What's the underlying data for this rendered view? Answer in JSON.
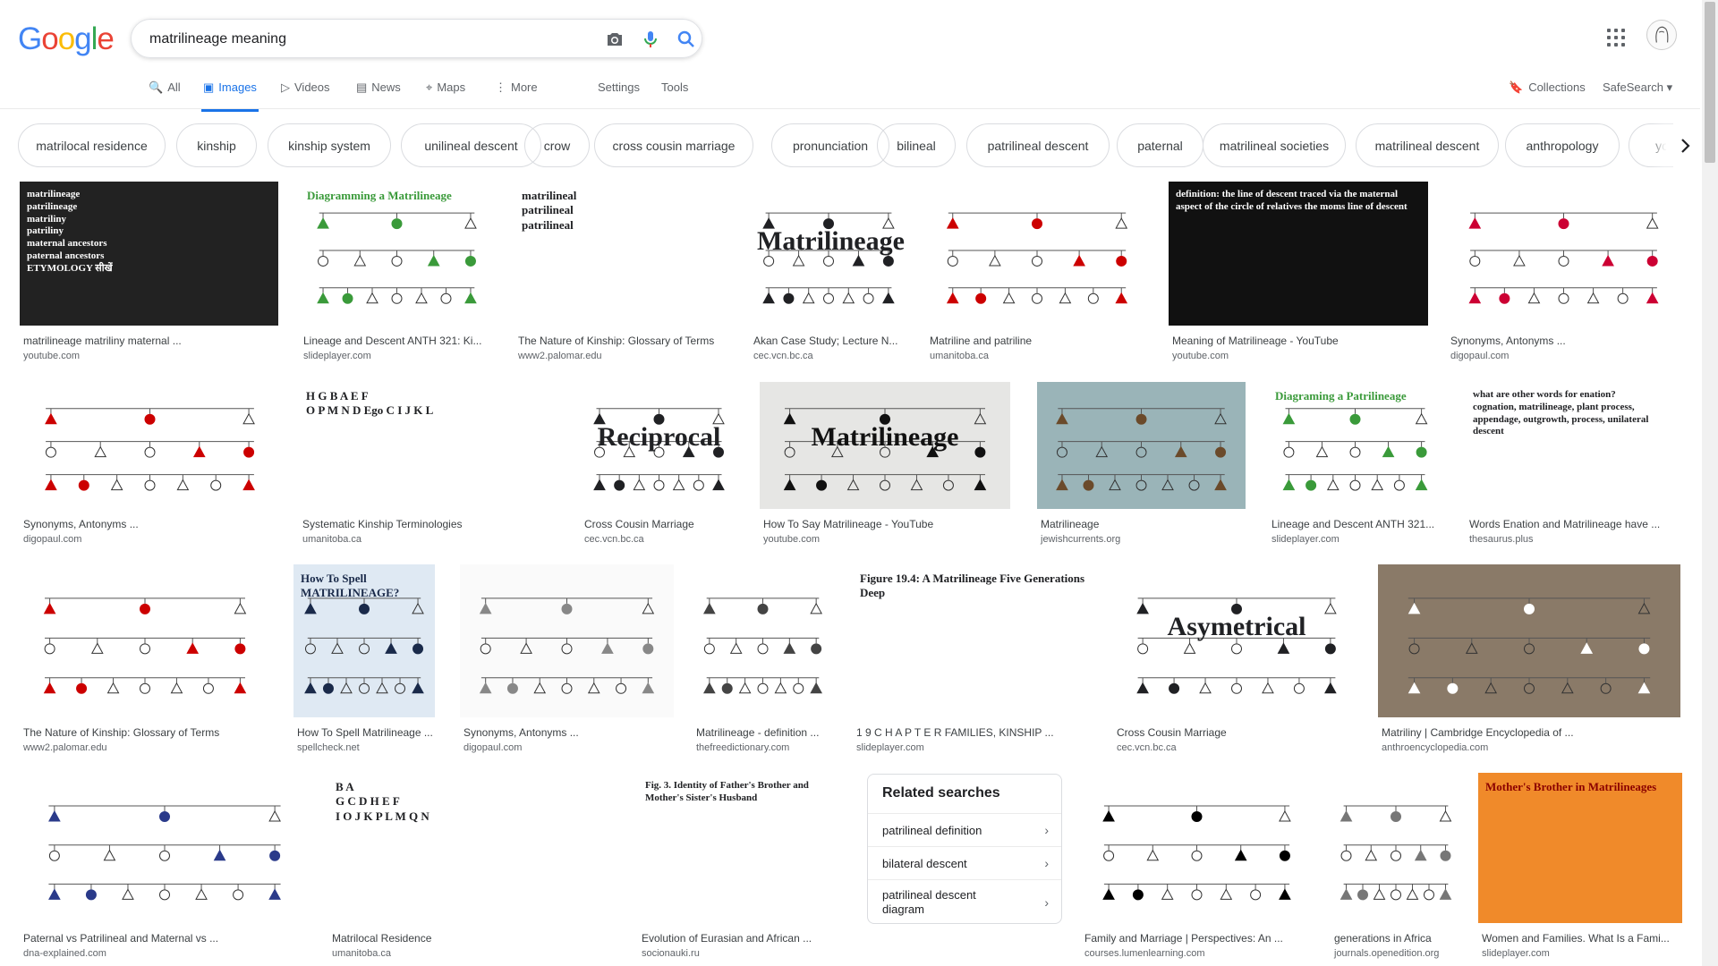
{
  "logo": {
    "letters": [
      "G",
      "o",
      "o",
      "g",
      "l",
      "e"
    ],
    "colors": [
      "#4285f4",
      "#ea4335",
      "#fbbc05",
      "#4285f4",
      "#34a853",
      "#ea4335"
    ]
  },
  "search": {
    "query": "matrilineage meaning"
  },
  "icons": {
    "camera": "camera-icon",
    "mic": "mic-icon",
    "search": "search-icon",
    "apps": "apps-grid-icon"
  },
  "tabs": [
    {
      "label": "All",
      "icon": "🔍"
    },
    {
      "label": "Images",
      "icon": "▣"
    },
    {
      "label": "Videos",
      "icon": "▷"
    },
    {
      "label": "News",
      "icon": "▤"
    },
    {
      "label": "Maps",
      "icon": "⌖"
    },
    {
      "label": "More",
      "icon": "⋮"
    },
    {
      "label": "Settings",
      "icon": ""
    },
    {
      "label": "Tools",
      "icon": ""
    }
  ],
  "right_tools": {
    "collections": "Collections",
    "safesearch": "SafeSearch"
  },
  "chips": [
    "matrilocal residence",
    "kinship",
    "kinship system",
    "unilineal descent",
    "crow",
    "cross cousin marriage",
    "pronunciation",
    "bilineal",
    "patrilineal descent",
    "paternal",
    "matrilineal societies",
    "matrilineal descent",
    "anthropology",
    "youtube"
  ],
  "results": [
    {
      "title": "matrilineage matriliny maternal ...",
      "source": "youtube.com",
      "thumb": {
        "bg": "#222222",
        "text": "matrilineage\npatrilineage\nmatriliny\npatriliny\nmaternal ancestors\npaternal ancestors\nETYMOLOGY सीखें",
        "fg": "#ffffff"
      }
    },
    {
      "title": "Lineage and Descent ANTH 321: Ki...",
      "source": "slideplayer.com",
      "thumb": {
        "bg": "#ffffff",
        "text": "Diagramming a Matrilineage",
        "fg": "#3a9a3a"
      }
    },
    {
      "title": "The Nature of Kinship: Glossary of Terms",
      "source": "www2.palomar.edu",
      "thumb": {
        "bg": "#ffffff",
        "text": "matrilineal\npatrilineal\npatrilineal",
        "fg": "#202124"
      }
    },
    {
      "title": "Akan Case Study; Lecture N...",
      "source": "cec.vcn.bc.ca",
      "thumb": {
        "bg": "#ffffff",
        "text": "Matrilineage",
        "fg": "#202124"
      }
    },
    {
      "title": "Matriline and patriline",
      "source": "umanitoba.ca",
      "thumb": {
        "bg": "#ffffff",
        "text": "",
        "fg": "#cc0000"
      }
    },
    {
      "title": "Meaning of Matrilineage - YouTube",
      "source": "youtube.com",
      "thumb": {
        "bg": "#111111",
        "text": "definition: the line of descent traced via the maternal aspect of the circle of relatives the moms line of descent",
        "fg": "#ffffff"
      }
    },
    {
      "title": "Synonyms, Antonyms ...",
      "source": "digopaul.com",
      "thumb": {
        "bg": "#ffffff",
        "text": "",
        "fg": "#cc0033"
      }
    },
    {
      "title": "Synonyms, Antonyms ...",
      "source": "digopaul.com",
      "thumb": {
        "bg": "#ffffff",
        "text": "",
        "fg": "#cc0000"
      }
    },
    {
      "title": "Systematic Kinship Terminologies",
      "source": "umanitoba.ca",
      "thumb": {
        "bg": "#ffffff",
        "text": "H G B A E F\nO P M N D Ego C I J K L",
        "fg": "#202124"
      }
    },
    {
      "title": "Cross Cousin Marriage",
      "source": "cec.vcn.bc.ca",
      "thumb": {
        "bg": "#ffffff",
        "text": "Reciprocal",
        "fg": "#202124"
      }
    },
    {
      "title": "How To Say Matrilineage - YouTube",
      "source": "youtube.com",
      "thumb": {
        "bg": "#e6e6e4",
        "text": "Matrilineage",
        "fg": "#111111"
      }
    },
    {
      "title": "Matrilineage",
      "source": "jewishcurrents.org",
      "thumb": {
        "bg": "#9ab4b8",
        "text": "",
        "fg": "#6b4a2a"
      }
    },
    {
      "title": "Lineage and Descent ANTH 321...",
      "source": "slideplayer.com",
      "thumb": {
        "bg": "#ffffff",
        "text": "Diagraming a Patrilineage",
        "fg": "#3a9a3a"
      }
    },
    {
      "title": "Words Enation and Matrilineage have ...",
      "source": "thesaurus.plus",
      "thumb": {
        "bg": "#ffffff",
        "text": "what are other words for enation?\ncognation, matrilineage, plant process, appendage, outgrowth, process, unilateral descent",
        "fg": "#202124"
      }
    },
    {
      "title": "The Nature of Kinship: Glossary of Terms",
      "source": "www2.palomar.edu",
      "thumb": {
        "bg": "#ffffff",
        "text": "",
        "fg": "#cc0000"
      }
    },
    {
      "title": "How To Spell Matrilineage ...",
      "source": "spellcheck.net",
      "thumb": {
        "bg": "#dfe9f3",
        "text": "How To Spell MATRILINEAGE?",
        "fg": "#1a2a4a"
      }
    },
    {
      "title": "Synonyms, Antonyms ...",
      "source": "digopaul.com",
      "thumb": {
        "bg": "#fafafa",
        "text": "",
        "fg": "#888888"
      }
    },
    {
      "title": "Matrilineage - definition ...",
      "source": "thefreedictionary.com",
      "thumb": {
        "bg": "#ffffff",
        "text": "",
        "fg": "#444444"
      }
    },
    {
      "title": "1 9 C H A P T E R FAMILIES, KINSHIP ...",
      "source": "slideplayer.com",
      "thumb": {
        "bg": "#ffffff",
        "text": "Figure 19.4: A Matrilineage Five Generations Deep",
        "fg": "#202124"
      }
    },
    {
      "title": "Cross Cousin Marriage",
      "source": "cec.vcn.bc.ca",
      "thumb": {
        "bg": "#ffffff",
        "text": "Asymetrical",
        "fg": "#202124"
      }
    },
    {
      "title": "Matriliny | Cambridge Encyclopedia of ...",
      "source": "anthroencyclopedia.com",
      "thumb": {
        "bg": "#8a7a68",
        "text": "",
        "fg": "#ffffff"
      }
    },
    {
      "title": "Paternal vs Patrilineal and Maternal vs ...",
      "source": "dna-explained.com",
      "thumb": {
        "bg": "#ffffff",
        "text": "",
        "fg": "#2a3a8a"
      }
    },
    {
      "title": "Matrilocal Residence",
      "source": "umanitoba.ca",
      "thumb": {
        "bg": "#ffffff",
        "text": "B A\nG C D H E F\nI O J K P L M Q N",
        "fg": "#202124"
      }
    },
    {
      "title": "Evolution of Eurasian and African ...",
      "source": "socionauki.ru",
      "thumb": {
        "bg": "#ffffff",
        "text": "Fig. 3. Identity of Father's Brother and Mother's Sister's Husband",
        "fg": "#202124"
      }
    },
    {
      "title": "Family and Marriage | Perspectives: An ...",
      "source": "courses.lumenlearning.com",
      "thumb": {
        "bg": "#ffffff",
        "text": "",
        "fg": "#000000"
      }
    },
    {
      "title": "generations in Africa",
      "source": "journals.openedition.org",
      "thumb": {
        "bg": "#ffffff",
        "text": "",
        "fg": "#777777"
      }
    },
    {
      "title": "Women and Families. What Is a Fami...",
      "source": "slideplayer.com",
      "thumb": {
        "bg": "#f08a2a",
        "text": "Mother's Brother in Matrilineages",
        "fg": "#8b0000"
      }
    }
  ],
  "related": {
    "title": "Related searches",
    "items": [
      "patrilineal definition",
      "bilateral descent",
      "patrilineal descent diagram"
    ]
  }
}
